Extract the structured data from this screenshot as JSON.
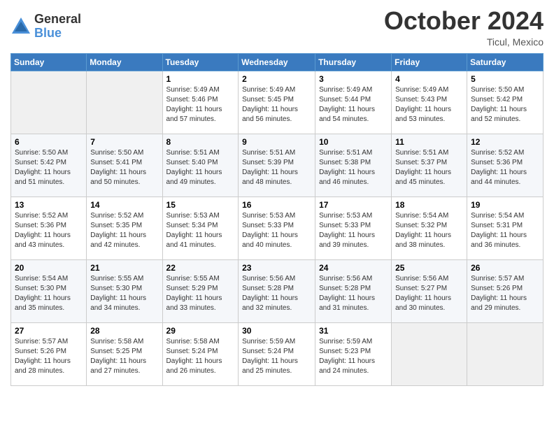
{
  "logo": {
    "general": "General",
    "blue": "Blue"
  },
  "title": "October 2024",
  "location": "Ticul, Mexico",
  "days_of_week": [
    "Sunday",
    "Monday",
    "Tuesday",
    "Wednesday",
    "Thursday",
    "Friday",
    "Saturday"
  ],
  "weeks": [
    [
      {
        "day": "",
        "sunrise": "",
        "sunset": "",
        "daylight": ""
      },
      {
        "day": "",
        "sunrise": "",
        "sunset": "",
        "daylight": ""
      },
      {
        "day": "1",
        "sunrise": "Sunrise: 5:49 AM",
        "sunset": "Sunset: 5:46 PM",
        "daylight": "Daylight: 11 hours and 57 minutes."
      },
      {
        "day": "2",
        "sunrise": "Sunrise: 5:49 AM",
        "sunset": "Sunset: 5:45 PM",
        "daylight": "Daylight: 11 hours and 56 minutes."
      },
      {
        "day": "3",
        "sunrise": "Sunrise: 5:49 AM",
        "sunset": "Sunset: 5:44 PM",
        "daylight": "Daylight: 11 hours and 54 minutes."
      },
      {
        "day": "4",
        "sunrise": "Sunrise: 5:49 AM",
        "sunset": "Sunset: 5:43 PM",
        "daylight": "Daylight: 11 hours and 53 minutes."
      },
      {
        "day": "5",
        "sunrise": "Sunrise: 5:50 AM",
        "sunset": "Sunset: 5:42 PM",
        "daylight": "Daylight: 11 hours and 52 minutes."
      }
    ],
    [
      {
        "day": "6",
        "sunrise": "Sunrise: 5:50 AM",
        "sunset": "Sunset: 5:42 PM",
        "daylight": "Daylight: 11 hours and 51 minutes."
      },
      {
        "day": "7",
        "sunrise": "Sunrise: 5:50 AM",
        "sunset": "Sunset: 5:41 PM",
        "daylight": "Daylight: 11 hours and 50 minutes."
      },
      {
        "day": "8",
        "sunrise": "Sunrise: 5:51 AM",
        "sunset": "Sunset: 5:40 PM",
        "daylight": "Daylight: 11 hours and 49 minutes."
      },
      {
        "day": "9",
        "sunrise": "Sunrise: 5:51 AM",
        "sunset": "Sunset: 5:39 PM",
        "daylight": "Daylight: 11 hours and 48 minutes."
      },
      {
        "day": "10",
        "sunrise": "Sunrise: 5:51 AM",
        "sunset": "Sunset: 5:38 PM",
        "daylight": "Daylight: 11 hours and 46 minutes."
      },
      {
        "day": "11",
        "sunrise": "Sunrise: 5:51 AM",
        "sunset": "Sunset: 5:37 PM",
        "daylight": "Daylight: 11 hours and 45 minutes."
      },
      {
        "day": "12",
        "sunrise": "Sunrise: 5:52 AM",
        "sunset": "Sunset: 5:36 PM",
        "daylight": "Daylight: 11 hours and 44 minutes."
      }
    ],
    [
      {
        "day": "13",
        "sunrise": "Sunrise: 5:52 AM",
        "sunset": "Sunset: 5:36 PM",
        "daylight": "Daylight: 11 hours and 43 minutes."
      },
      {
        "day": "14",
        "sunrise": "Sunrise: 5:52 AM",
        "sunset": "Sunset: 5:35 PM",
        "daylight": "Daylight: 11 hours and 42 minutes."
      },
      {
        "day": "15",
        "sunrise": "Sunrise: 5:53 AM",
        "sunset": "Sunset: 5:34 PM",
        "daylight": "Daylight: 11 hours and 41 minutes."
      },
      {
        "day": "16",
        "sunrise": "Sunrise: 5:53 AM",
        "sunset": "Sunset: 5:33 PM",
        "daylight": "Daylight: 11 hours and 40 minutes."
      },
      {
        "day": "17",
        "sunrise": "Sunrise: 5:53 AM",
        "sunset": "Sunset: 5:33 PM",
        "daylight": "Daylight: 11 hours and 39 minutes."
      },
      {
        "day": "18",
        "sunrise": "Sunrise: 5:54 AM",
        "sunset": "Sunset: 5:32 PM",
        "daylight": "Daylight: 11 hours and 38 minutes."
      },
      {
        "day": "19",
        "sunrise": "Sunrise: 5:54 AM",
        "sunset": "Sunset: 5:31 PM",
        "daylight": "Daylight: 11 hours and 36 minutes."
      }
    ],
    [
      {
        "day": "20",
        "sunrise": "Sunrise: 5:54 AM",
        "sunset": "Sunset: 5:30 PM",
        "daylight": "Daylight: 11 hours and 35 minutes."
      },
      {
        "day": "21",
        "sunrise": "Sunrise: 5:55 AM",
        "sunset": "Sunset: 5:30 PM",
        "daylight": "Daylight: 11 hours and 34 minutes."
      },
      {
        "day": "22",
        "sunrise": "Sunrise: 5:55 AM",
        "sunset": "Sunset: 5:29 PM",
        "daylight": "Daylight: 11 hours and 33 minutes."
      },
      {
        "day": "23",
        "sunrise": "Sunrise: 5:56 AM",
        "sunset": "Sunset: 5:28 PM",
        "daylight": "Daylight: 11 hours and 32 minutes."
      },
      {
        "day": "24",
        "sunrise": "Sunrise: 5:56 AM",
        "sunset": "Sunset: 5:28 PM",
        "daylight": "Daylight: 11 hours and 31 minutes."
      },
      {
        "day": "25",
        "sunrise": "Sunrise: 5:56 AM",
        "sunset": "Sunset: 5:27 PM",
        "daylight": "Daylight: 11 hours and 30 minutes."
      },
      {
        "day": "26",
        "sunrise": "Sunrise: 5:57 AM",
        "sunset": "Sunset: 5:26 PM",
        "daylight": "Daylight: 11 hours and 29 minutes."
      }
    ],
    [
      {
        "day": "27",
        "sunrise": "Sunrise: 5:57 AM",
        "sunset": "Sunset: 5:26 PM",
        "daylight": "Daylight: 11 hours and 28 minutes."
      },
      {
        "day": "28",
        "sunrise": "Sunrise: 5:58 AM",
        "sunset": "Sunset: 5:25 PM",
        "daylight": "Daylight: 11 hours and 27 minutes."
      },
      {
        "day": "29",
        "sunrise": "Sunrise: 5:58 AM",
        "sunset": "Sunset: 5:24 PM",
        "daylight": "Daylight: 11 hours and 26 minutes."
      },
      {
        "day": "30",
        "sunrise": "Sunrise: 5:59 AM",
        "sunset": "Sunset: 5:24 PM",
        "daylight": "Daylight: 11 hours and 25 minutes."
      },
      {
        "day": "31",
        "sunrise": "Sunrise: 5:59 AM",
        "sunset": "Sunset: 5:23 PM",
        "daylight": "Daylight: 11 hours and 24 minutes."
      },
      {
        "day": "",
        "sunrise": "",
        "sunset": "",
        "daylight": ""
      },
      {
        "day": "",
        "sunrise": "",
        "sunset": "",
        "daylight": ""
      }
    ]
  ]
}
